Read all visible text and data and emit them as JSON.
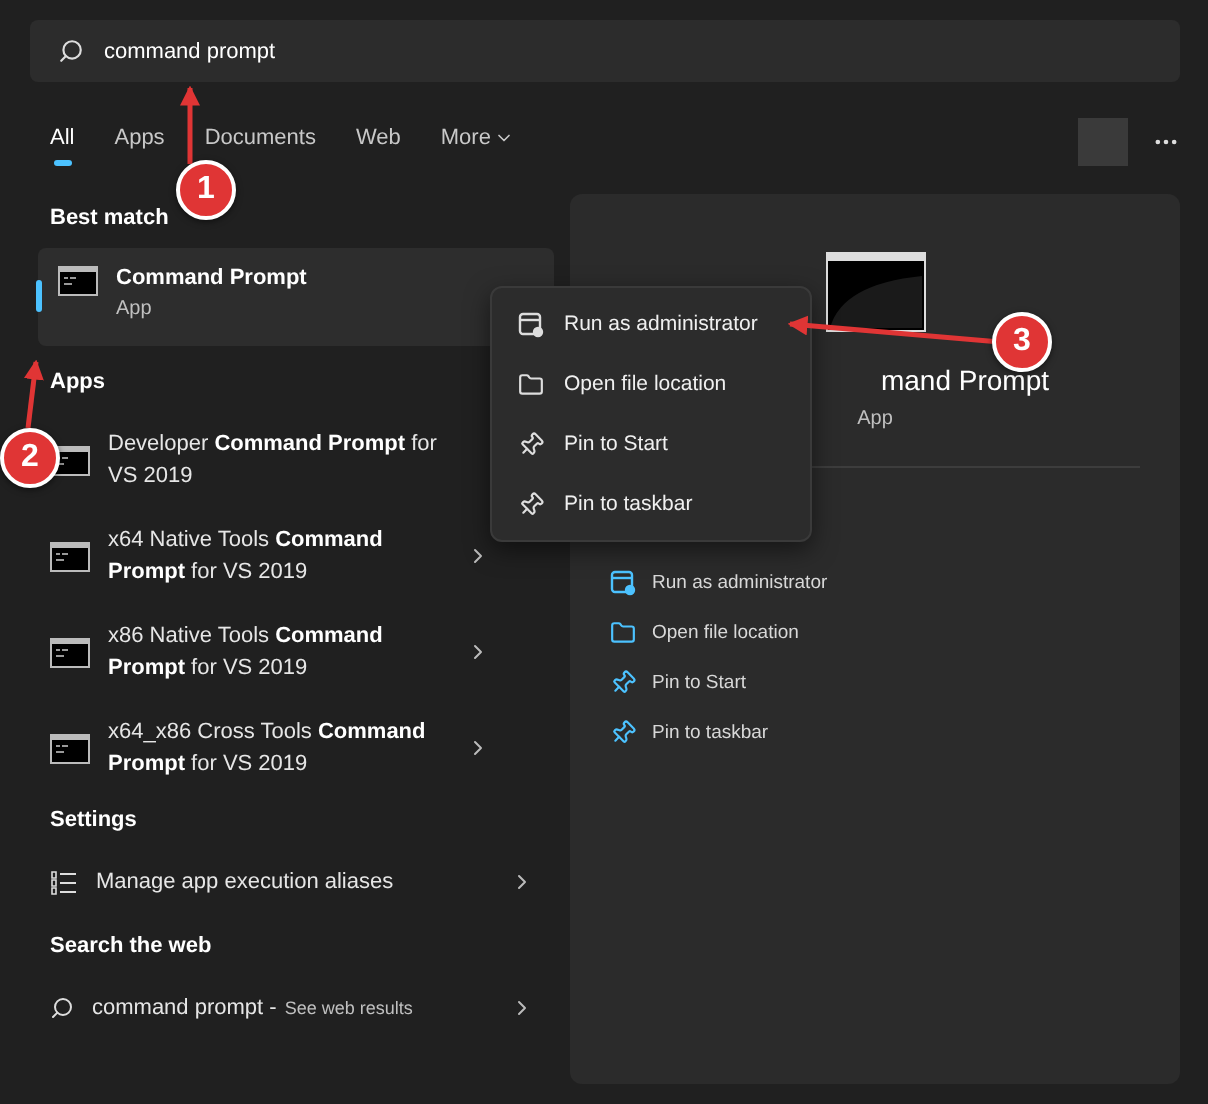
{
  "search": {
    "value": "command prompt"
  },
  "tabs": [
    {
      "label": "All",
      "selected": true,
      "dropdown": false
    },
    {
      "label": "Apps",
      "selected": false,
      "dropdown": false
    },
    {
      "label": "Documents",
      "selected": false,
      "dropdown": false
    },
    {
      "label": "Web",
      "selected": false,
      "dropdown": false
    },
    {
      "label": "More",
      "selected": false,
      "dropdown": true
    }
  ],
  "best_match": {
    "heading": "Best match",
    "title": "Command Prompt",
    "subtitle": "App",
    "selected": true
  },
  "apps": {
    "heading": "Apps",
    "items": [
      {
        "label": "Developer **Command Prompt** for VS 2019"
      },
      {
        "label": "x64 Native Tools **Command Prompt** for VS 2019",
        "chevron": true
      },
      {
        "label": "x86 Native Tools **Command Prompt** for VS 2019",
        "chevron": true
      },
      {
        "label": "x64_x86 Cross Tools **Command Prompt** for VS 2019",
        "chevron": true
      }
    ]
  },
  "settings": {
    "heading": "Settings",
    "items": [
      {
        "label": "Manage app execution aliases"
      }
    ]
  },
  "web": {
    "heading": "Search the web",
    "query": "command prompt -",
    "hint": "See web results"
  },
  "detail": {
    "title": "mand Prompt",
    "subtitle": "App",
    "actions": [
      {
        "kind": "admin",
        "label": "Run as administrator"
      },
      {
        "kind": "folder",
        "label": "Open file location"
      },
      {
        "kind": "pin",
        "label": "Pin to Start"
      },
      {
        "kind": "pin",
        "label": "Pin to taskbar"
      }
    ]
  },
  "context_menu": {
    "items": [
      {
        "kind": "admin",
        "label": "Run as administrator"
      },
      {
        "kind": "folder",
        "label": "Open file location"
      },
      {
        "kind": "pin",
        "label": "Pin to Start"
      },
      {
        "kind": "pin",
        "label": "Pin to taskbar"
      }
    ]
  },
  "annotations": [
    {
      "label": "1"
    },
    {
      "label": "2"
    },
    {
      "label": "3"
    }
  ]
}
